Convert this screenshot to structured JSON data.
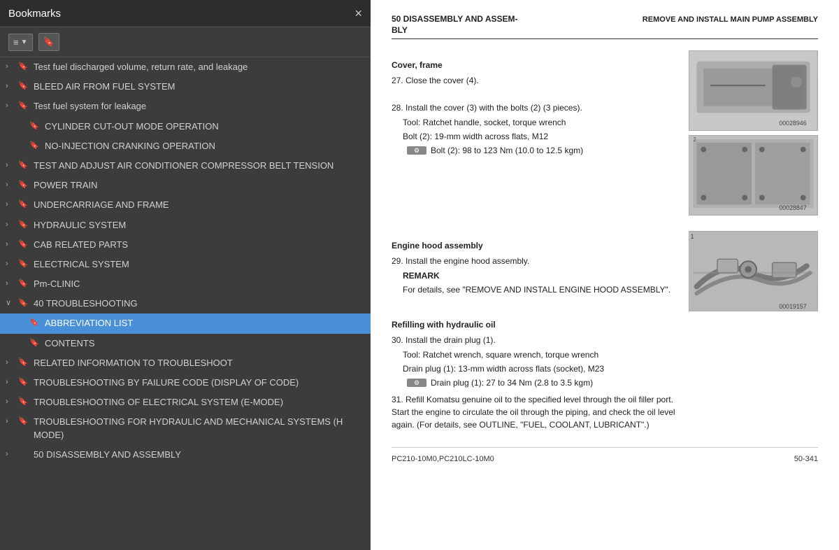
{
  "sidebar": {
    "title": "Bookmarks",
    "close_label": "×",
    "toolbar": {
      "btn1_label": "≡",
      "btn1_arrow": "▼",
      "btn2_label": "🔖"
    },
    "items": [
      {
        "id": "fuel-test",
        "label": "Test fuel discharged volume, return rate, and leakage",
        "indent": 0,
        "toggle": "›",
        "has_bookmark": true,
        "active": false
      },
      {
        "id": "bleed-air",
        "label": "BLEED AIR FROM FUEL SYSTEM",
        "indent": 0,
        "toggle": "›",
        "has_bookmark": true,
        "active": false
      },
      {
        "id": "fuel-leakage",
        "label": "Test fuel system for leakage",
        "indent": 0,
        "toggle": "›",
        "has_bookmark": true,
        "active": false
      },
      {
        "id": "cylinder-cutout",
        "label": "CYLINDER CUT-OUT MODE OPERATION",
        "indent": 1,
        "toggle": "",
        "has_bookmark": true,
        "active": false
      },
      {
        "id": "no-injection",
        "label": "NO-INJECTION CRANKING OPERATION",
        "indent": 1,
        "toggle": "",
        "has_bookmark": true,
        "active": false
      },
      {
        "id": "air-conditioner",
        "label": "TEST AND ADJUST AIR CONDITIONER COMPRESSOR BELT TENSION",
        "indent": 0,
        "toggle": "›",
        "has_bookmark": true,
        "active": false
      },
      {
        "id": "power-train",
        "label": "POWER TRAIN",
        "indent": 0,
        "toggle": "›",
        "has_bookmark": true,
        "active": false
      },
      {
        "id": "undercarriage",
        "label": "UNDERCARRIAGE AND FRAME",
        "indent": 0,
        "toggle": "›",
        "has_bookmark": true,
        "active": false
      },
      {
        "id": "hydraulic-system",
        "label": "HYDRAULIC SYSTEM",
        "indent": 0,
        "toggle": "›",
        "has_bookmark": true,
        "active": false
      },
      {
        "id": "cab-related",
        "label": "CAB RELATED PARTS",
        "indent": 0,
        "toggle": "›",
        "has_bookmark": true,
        "active": false
      },
      {
        "id": "electrical-system",
        "label": "ELECTRICAL SYSTEM",
        "indent": 0,
        "toggle": "›",
        "has_bookmark": true,
        "active": false
      },
      {
        "id": "pm-clinic",
        "label": "Pm-CLINIC",
        "indent": 0,
        "toggle": "›",
        "has_bookmark": true,
        "active": false
      },
      {
        "id": "40-troubleshoot",
        "label": "40 TROUBLESHOOTING",
        "indent": 0,
        "toggle": "∨",
        "has_bookmark": true,
        "active": false
      },
      {
        "id": "abbreviation-list",
        "label": "ABBREVIATION LIST",
        "indent": 1,
        "toggle": "",
        "has_bookmark": true,
        "active": true
      },
      {
        "id": "contents",
        "label": "CONTENTS",
        "indent": 1,
        "toggle": "",
        "has_bookmark": true,
        "active": false
      },
      {
        "id": "related-info",
        "label": "RELATED INFORMATION TO TROUBLESHOOT",
        "indent": 0,
        "toggle": "›",
        "has_bookmark": true,
        "active": false
      },
      {
        "id": "troubleshoot-failure",
        "label": "TROUBLESHOOTING BY FAILURE CODE (DISPLAY OF CODE)",
        "indent": 0,
        "toggle": "›",
        "has_bookmark": true,
        "active": false
      },
      {
        "id": "troubleshoot-electrical",
        "label": "TROUBLESHOOTING OF ELECTRICAL SYSTEM (E-MODE)",
        "indent": 0,
        "toggle": "›",
        "has_bookmark": true,
        "active": false
      },
      {
        "id": "troubleshoot-hydraulic",
        "label": "TROUBLESHOOTING FOR HYDRAULIC AND MECHANICAL SYSTEMS (H MODE)",
        "indent": 0,
        "toggle": "›",
        "has_bookmark": true,
        "active": false
      },
      {
        "id": "50-disassembly",
        "label": "50 DISASSEMBLY AND ASSEMBLY",
        "indent": 0,
        "toggle": "›",
        "has_bookmark": false,
        "active": false
      }
    ]
  },
  "main": {
    "header_left_line1": "50 DISASSEMBLY AND ASSEM-",
    "header_left_line2": "BLY",
    "header_right": "REMOVE AND INSTALL MAIN PUMP ASSEMBLY",
    "section1_title": "Cover, frame",
    "step27": "27.  Close the cover (4).",
    "step28_intro": "28.  Install the cover (3) with the bolts (2) (3 pieces).",
    "step28_tool": "Tool: Ratchet handle, socket, torque wrench",
    "step28_bolt": "Bolt (2): 19-mm width across flats, M12",
    "step28_torque": "Bolt (2): 98 to 123 Nm (10.0 to 12.5 kgm)",
    "image1_label": "00028946",
    "image2_label": "00028847",
    "section2_title": "Engine hood assembly",
    "step29_intro": "29.  Install the engine hood assembly.",
    "step29_remark_label": "REMARK",
    "step29_remark": "For details, see \"REMOVE AND INSTALL ENGINE HOOD ASSEMBLY\".",
    "section3_title": "Refilling with hydraulic oil",
    "step30_intro": "30.  Install the drain plug (1).",
    "step30_tool": "Tool: Ratchet wrench, square wrench, torque wrench",
    "step30_drain": "Drain plug (1): 13-mm width across flats (socket), M23",
    "step30_torque": "Drain plug (1): 27 to 34 Nm (2.8 to 3.5 kgm)",
    "step31": "31.  Refill Komatsu genuine oil to the specified level through the oil filler port. Start the engine to circulate the oil through the piping, and check the oil level again. (For details, see OUTLINE, \"FUEL, COOLANT, LUBRICANT\".)",
    "image3_label": "00019157",
    "footer_left": "PC210-10M0,PC210LC-10M0",
    "footer_right": "50-341"
  }
}
